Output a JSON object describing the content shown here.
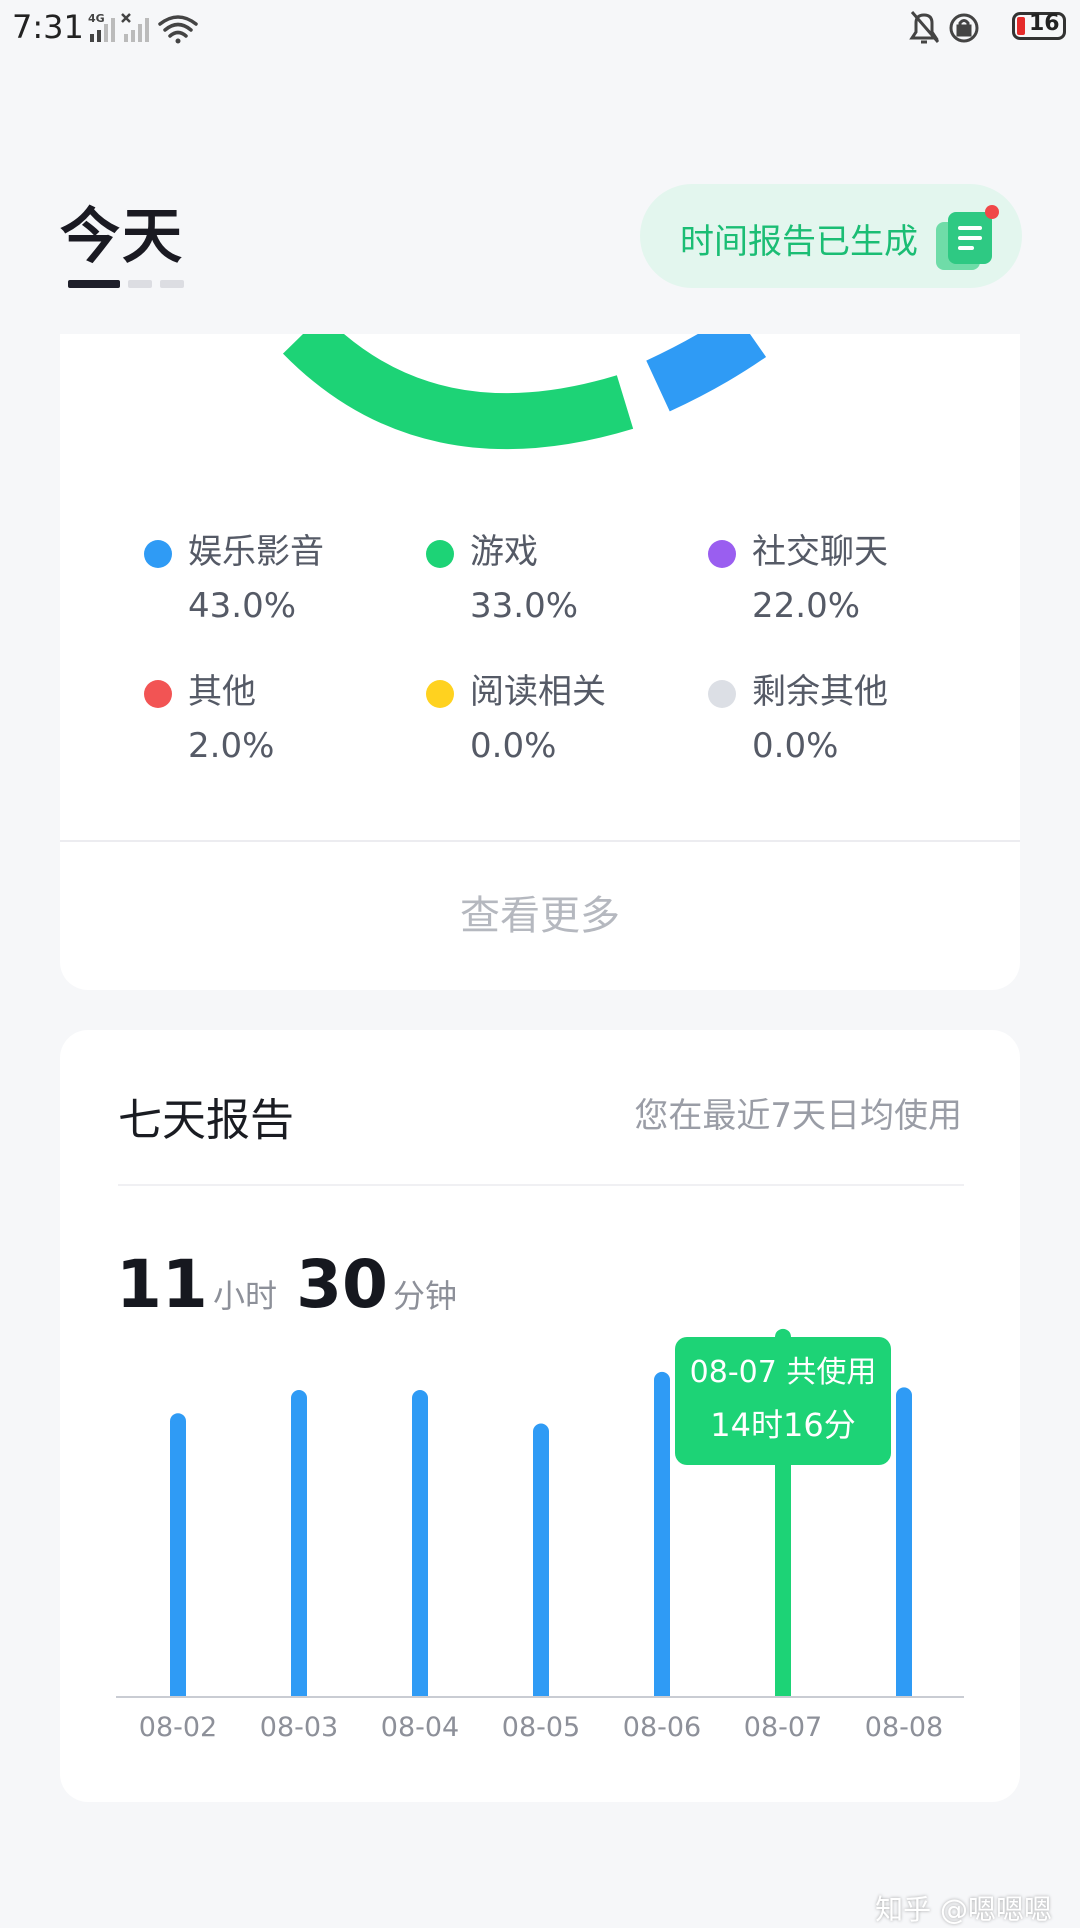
{
  "status_bar": {
    "time": "7:31",
    "network": "4G",
    "battery": "16",
    "battery_color": "#e52b2b"
  },
  "header": {
    "title": "今天",
    "report_notice": "时间报告已生成",
    "report_icon": "report-doc-icon",
    "notice_dot_color": "#f04848"
  },
  "category_breakdown": {
    "colors": {
      "entertainment": "#2f9bf5",
      "game": "#1dd376",
      "social": "#9a5ef0",
      "other": "#f25454",
      "reading": "#ffd21f",
      "remaining": "#dcdfe5"
    },
    "items": [
      {
        "label": "娱乐影音",
        "percent": "43.0%",
        "value": 43.0,
        "color": "#2f9bf5"
      },
      {
        "label": "游戏",
        "percent": "33.0%",
        "value": 33.0,
        "color": "#1dd376"
      },
      {
        "label": "社交聊天",
        "percent": "22.0%",
        "value": 22.0,
        "color": "#9a5ef0"
      },
      {
        "label": "其他",
        "percent": "2.0%",
        "value": 2.0,
        "color": "#f25454"
      },
      {
        "label": "阅读相关",
        "percent": "0.0%",
        "value": 0.0,
        "color": "#ffd21f"
      },
      {
        "label": "剩余其他",
        "percent": "0.0%",
        "value": 0.0,
        "color": "#dcdfe5"
      }
    ],
    "more_label": "查看更多"
  },
  "weekly_report": {
    "title": "七天报告",
    "subtitle": "您在最近7天日均使用",
    "avg_hours": "11",
    "hours_unit": "小时",
    "avg_minutes": "30",
    "minutes_unit": "分钟"
  },
  "chart_data": {
    "type": "bar",
    "categories": [
      "08-02",
      "08-03",
      "08-04",
      "08-05",
      "08-06",
      "08-07",
      "08-08"
    ],
    "values": [
      11.0,
      11.9,
      11.9,
      10.6,
      12.6,
      14.27,
      12.0
    ],
    "ylim": [
      0,
      15
    ],
    "highlight_index": 5,
    "bar_color": "#2f9bf5",
    "highlight_color": "#1dd376",
    "tooltip": {
      "line1": "08-07 共使用",
      "line2": "14时16分"
    },
    "grid": false
  },
  "watermark": "知乎 @嗯嗯嗯"
}
